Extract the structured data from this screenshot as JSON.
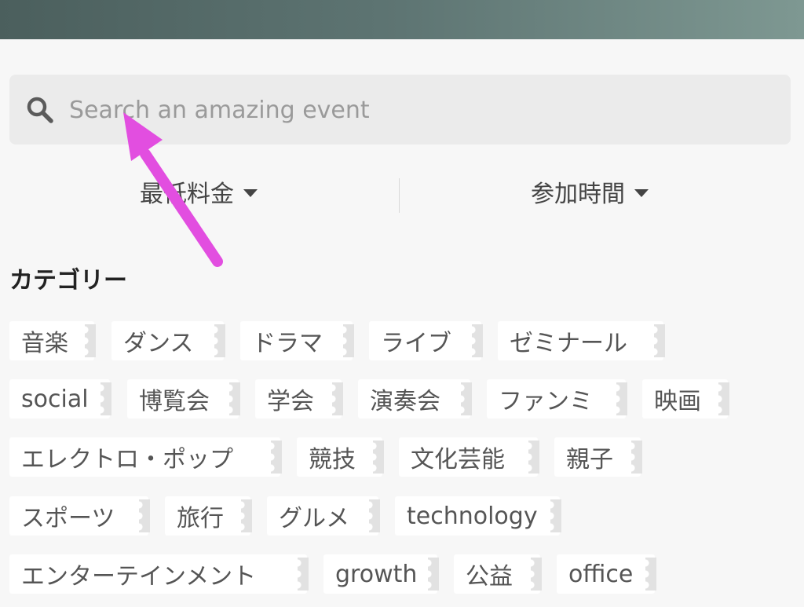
{
  "colors": {
    "header_gradient": [
      "#4b5f5d",
      "#7e9892"
    ],
    "background": "#f7f7f7",
    "search_box": "#ebebeb",
    "tag_background": "#ffffff",
    "arrow": "#e24ee0"
  },
  "search": {
    "placeholder": "Search an amazing event",
    "value": "",
    "icon": "search-icon"
  },
  "filters": {
    "price_label": "最低料金",
    "time_label": "参加時間",
    "icon": "caret-down-icon"
  },
  "category": {
    "heading": "カテゴリー",
    "tags": [
      "音楽",
      "ダンス",
      "ドラマ",
      "ライブ",
      "ゼミナール",
      "social",
      "博覧会",
      "学会",
      "演奏会",
      "ファンミ",
      "映画",
      "エレクトロ・ポップ",
      "競技",
      "文化芸能",
      "親子",
      "スポーツ",
      "旅行",
      "グルメ",
      "technology",
      "エンターテインメント",
      "growth",
      "公益",
      "office"
    ]
  }
}
